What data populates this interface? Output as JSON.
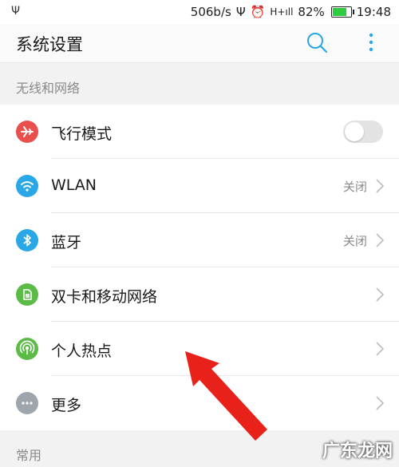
{
  "status_bar": {
    "speed": "506b/s",
    "signal": "H+ıll",
    "battery_pct": "82%",
    "battery_level": 0.82,
    "time": "19:48"
  },
  "app_bar": {
    "title": "系统设置"
  },
  "sections": [
    {
      "header": "无线和网络"
    },
    {
      "header": "常用"
    }
  ],
  "rows": [
    {
      "label": "飞行模式",
      "icon": "airplane-icon",
      "color": "#e9504d",
      "toggle_on": false
    },
    {
      "label": "WLAN",
      "value": "关闭",
      "icon": "wifi-icon",
      "color": "#2aa7e6"
    },
    {
      "label": "蓝牙",
      "value": "关闭",
      "icon": "bluetooth-icon",
      "color": "#2aa7e6"
    },
    {
      "label": "双卡和移动网络",
      "icon": "sim-card-icon",
      "color": "#5cba47"
    },
    {
      "label": "个人热点",
      "icon": "hotspot-icon",
      "color": "#5cba47"
    },
    {
      "label": "更多",
      "icon": "more-dots-icon",
      "color": "#9ea6ad"
    }
  ],
  "watermark": "广东龙网",
  "colors": {
    "annotation_arrow": "#e8211b",
    "accent": "#2aa7e6"
  }
}
